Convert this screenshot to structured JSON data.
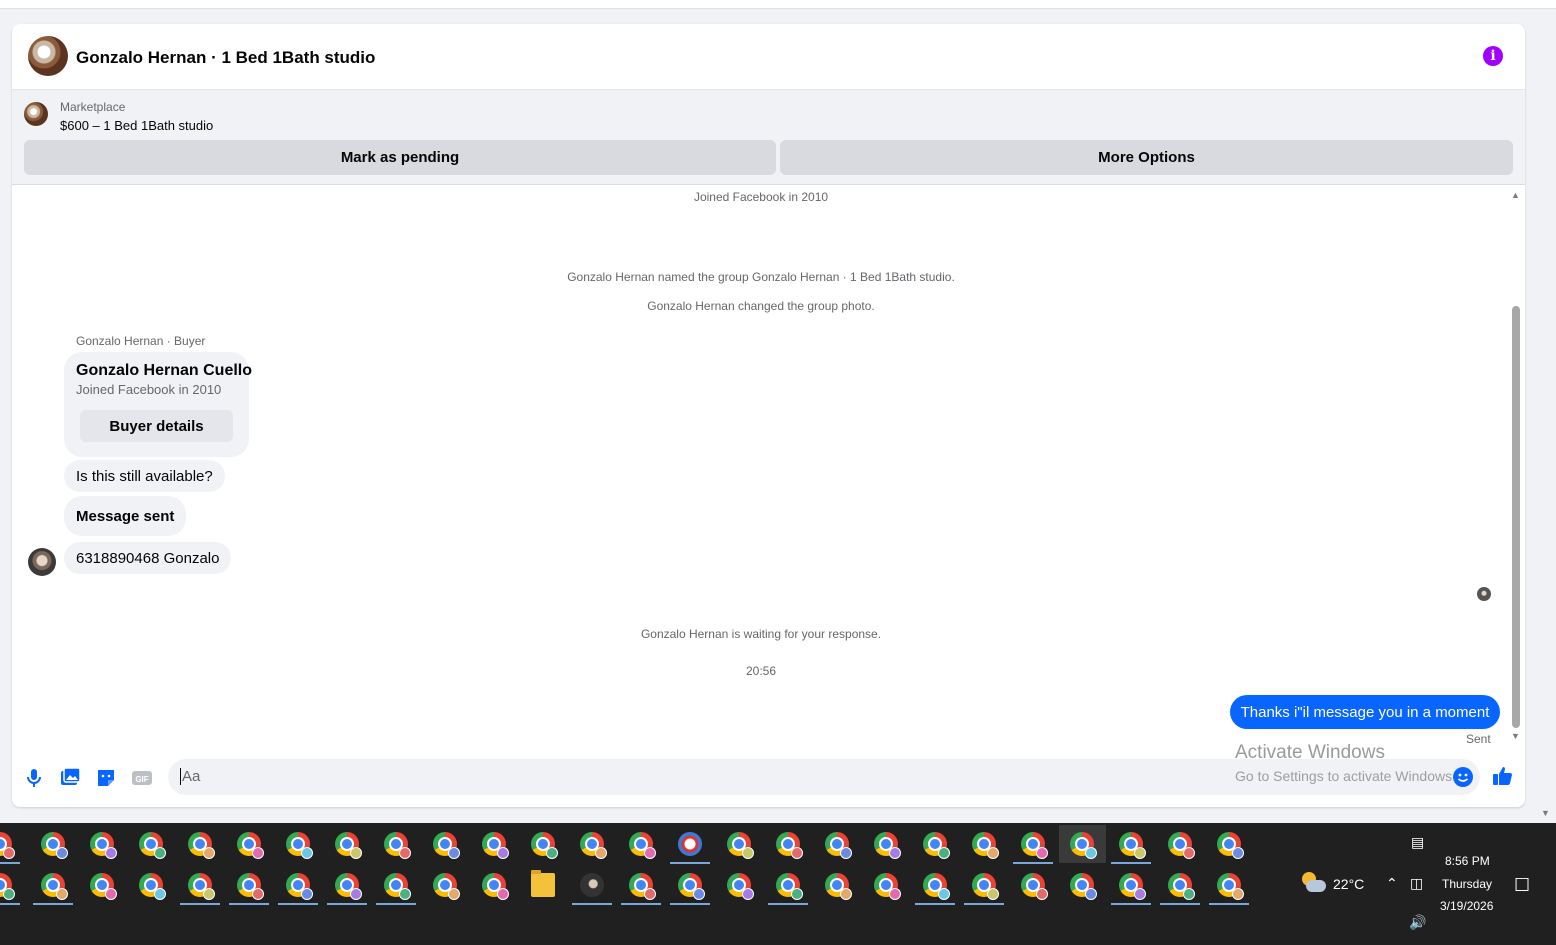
{
  "header": {
    "title": "Gonzalo Hernan · 1 Bed 1Bath studio",
    "info_icon": "i"
  },
  "listing": {
    "label": "Marketplace",
    "item": "$600 – 1 Bed 1Bath studio",
    "pending_button": "Mark as pending",
    "more_button": "More Options"
  },
  "thread": {
    "joined_top": "Joined Facebook in 2010",
    "named_group": "Gonzalo Hernan named the group Gonzalo Hernan · 1 Bed 1Bath studio.",
    "changed_photo": "Gonzalo Hernan changed the group photo.",
    "sender_label": "Gonzalo Hernan · Buyer",
    "buyer_card": {
      "name": "Gonzalo Hernan Cuello",
      "joined": "Joined Facebook in 2010",
      "button": "Buyer details"
    },
    "incoming": [
      "Is this still available?",
      "Message sent",
      "6318890468 Gonzalo"
    ],
    "waiting": "Gonzalo Hernan is waiting for your response.",
    "timestamp": "20:56",
    "outgoing": "Thanks i\"il message you in a moment",
    "status": "Sent"
  },
  "composer": {
    "placeholder": "Aa",
    "icons": [
      "microphone-icon",
      "photo-icon",
      "sticker-icon",
      "gif-icon",
      "emoji-icon",
      "thumbs-up-icon"
    ],
    "gif_label": "GIF"
  },
  "watermark": {
    "line1": "Activate Windows",
    "line2": "Go to Settings to activate Windows."
  },
  "taskbar": {
    "temperature": "22°C",
    "time": "8:56 PM",
    "day": "Thursday",
    "date": "3/19/2026"
  },
  "colors": {
    "accent_blue": "#0866ff",
    "info_purple": "#a100ff",
    "taskbar_bg": "#202020"
  }
}
